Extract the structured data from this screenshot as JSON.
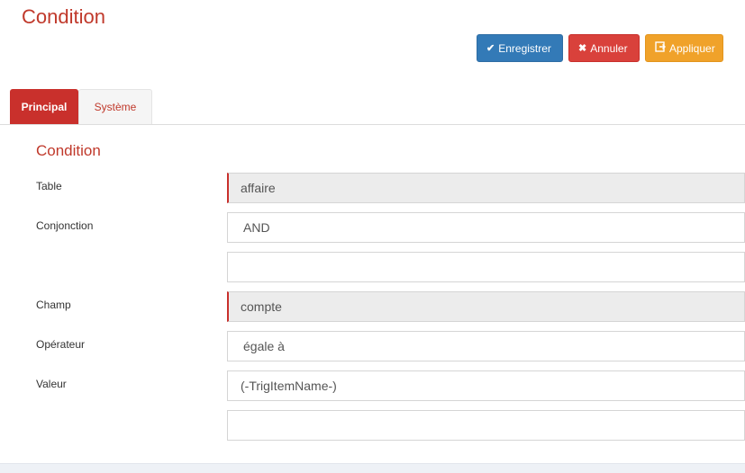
{
  "page": {
    "title": "Condition"
  },
  "toolbar": {
    "save_label": "Enregistrer",
    "cancel_label": "Annuler",
    "apply_label": "Appliquer"
  },
  "tabs": [
    {
      "label": "Principal",
      "active": true
    },
    {
      "label": "Système",
      "active": false
    }
  ],
  "section": {
    "title": "Condition"
  },
  "form": {
    "table": {
      "label": "Table",
      "value": "affaire"
    },
    "conjonction": {
      "label": "Conjonction",
      "value": "AND",
      "extra_value": ""
    },
    "champ": {
      "label": "Champ",
      "value": "compte"
    },
    "operateur": {
      "label": "Opérateur",
      "value": "égale à"
    },
    "valeur": {
      "label": "Valeur",
      "value": "(-TrigItemName-)",
      "extra_value": ""
    }
  },
  "colors": {
    "accent": "#c0392b",
    "primary": "#337ab7",
    "danger": "#d9413b",
    "warning": "#f0a22a"
  },
  "icons": {
    "save": "check-icon",
    "cancel": "x-icon",
    "apply": "apply-icon"
  }
}
